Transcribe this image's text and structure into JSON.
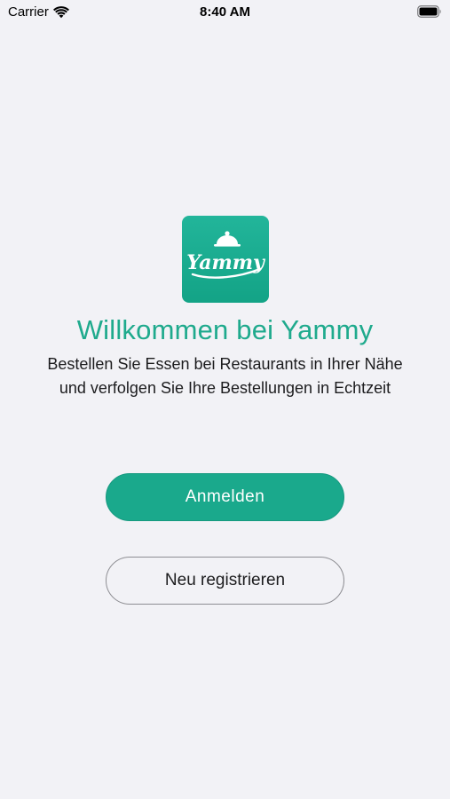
{
  "status_bar": {
    "carrier": "Carrier",
    "time": "8:40 AM",
    "wifi_icon": "wifi-icon",
    "battery_icon": "battery-icon"
  },
  "logo": {
    "text": "Yammy",
    "icon": "cloche-icon",
    "background_color": "#1aa98c"
  },
  "welcome": {
    "title": "Willkommen bei Yammy",
    "subtitle": "Bestellen Sie Essen bei Restaurants in Ihrer Nähe und verfolgen Sie Ihre Bestellungen in Echtzeit"
  },
  "buttons": {
    "login_label": "Anmelden",
    "register_label": "Neu registrieren"
  },
  "colors": {
    "accent": "#1aa98c",
    "background": "#f2f2f6"
  }
}
